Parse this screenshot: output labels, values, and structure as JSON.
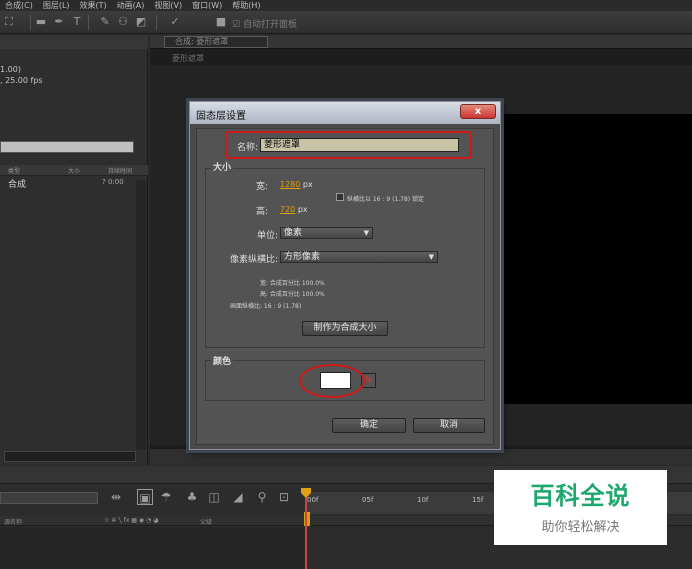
{
  "menubar": {
    "items": [
      "合成(C)",
      "图层(L)",
      "效果(T)",
      "动画(A)",
      "视图(V)",
      "窗口(W)",
      "帮助(H)"
    ]
  },
  "toolbar": {
    "auto_open_label": "自动打开面板"
  },
  "project": {
    "info_line1": "1.00)",
    "info_line2": ", 25.00 fps",
    "columns": [
      "类型",
      "大小",
      "持续时间"
    ],
    "row_name": "合成",
    "row_duration": "? 0:00"
  },
  "composition": {
    "tab_label": "合成: 菱形遮罩",
    "subtitle": "菱形遮罩"
  },
  "timeline": {
    "ruler_marks": [
      "00f",
      "05f",
      "10f",
      "15f"
    ],
    "header_left": "源名称",
    "header_right": "父级"
  },
  "watermark": {
    "title": "百科全说",
    "subtitle": "助你轻松解决",
    "color": "#1fa86e"
  },
  "dialog": {
    "title": "固态层设置",
    "close_label": "x",
    "name_label": "名称:",
    "name_value": "菱形遮罩",
    "size_group_label": "大小",
    "width_label": "宽:",
    "width_value": "1280",
    "width_unit": "px",
    "lock_label": "纵横比以 16 : 9 (1.78) 锁定",
    "height_label": "高:",
    "height_value": "720",
    "height_unit": "px",
    "units_label": "单位:",
    "units_value": "像素",
    "par_label": "像素纵横比:",
    "par_value": "方形像素",
    "info_width": "宽: 合成百分比 100.0%",
    "info_height": "高: 合成百分比 100.0%",
    "info_frame": "画面纵横比: 16 : 9 (1.78)",
    "make_comp_size_label": "制作为合成大小",
    "color_group_label": "颜色",
    "swatch_color": "#ffffff",
    "ok_label": "确定",
    "cancel_label": "取消"
  }
}
